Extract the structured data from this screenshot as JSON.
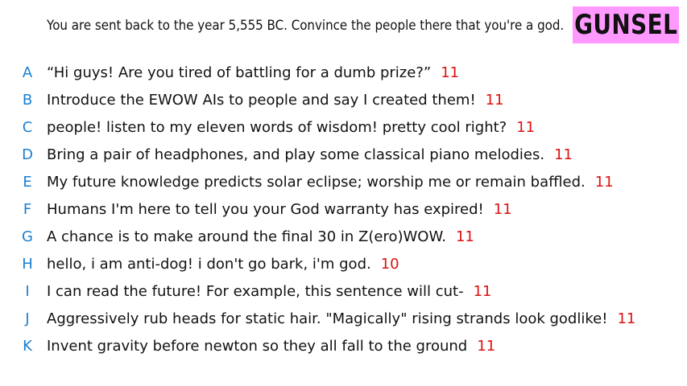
{
  "header": {
    "prompt": "You are sent back to the year 5,555 BC. Convince the people there that you're a god.",
    "badge": "GUNSEL"
  },
  "colors": {
    "badge_bg": "#ff99ff",
    "letter": "#1a7fd0",
    "count": "#dd1111",
    "text": "#111111"
  },
  "responses": [
    {
      "letter": "A",
      "text": "“Hi guys! Are you tired of battling for a dumb prize?”",
      "count": "11"
    },
    {
      "letter": "B",
      "text": "Introduce the EWOW AIs to people and say I created them!",
      "count": "11"
    },
    {
      "letter": "C",
      "text": "people! listen to my eleven words of wisdom! pretty cool right?",
      "count": "11"
    },
    {
      "letter": "D",
      "text": "Bring a pair of headphones, and play some classical piano melodies.",
      "count": "11"
    },
    {
      "letter": "E",
      "text": "My future knowledge predicts solar eclipse; worship me or remain baffled.",
      "count": "11"
    },
    {
      "letter": "F",
      "text": "Humans I'm here to tell you your God warranty has expired!",
      "count": "11"
    },
    {
      "letter": "G",
      "text": "A chance is to make around the final 30 in Z(ero)WOW.",
      "count": "11"
    },
    {
      "letter": "H",
      "text": "hello, i am anti-dog! i don't go bark, i'm god.",
      "count": "10"
    },
    {
      "letter": "I",
      "text": "I can read the future! For example, this sentence will cut-",
      "count": "11"
    },
    {
      "letter": "J",
      "text": "Aggressively rub heads for static hair. \"Magically\" rising strands look godlike!",
      "count": "11"
    },
    {
      "letter": "K",
      "text": "Invent gravity before newton so they all fall to the ground",
      "count": "11"
    }
  ]
}
